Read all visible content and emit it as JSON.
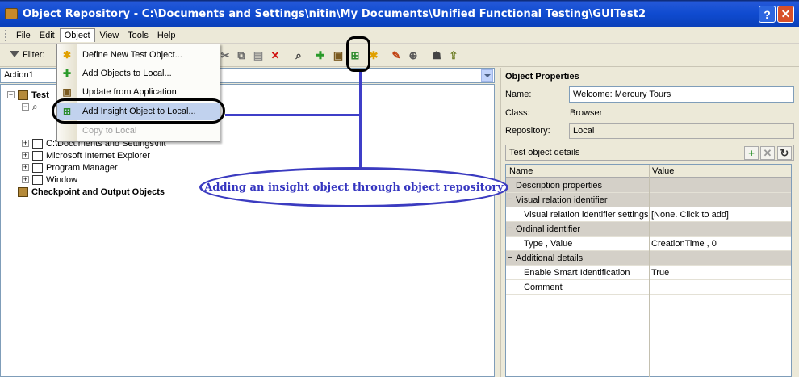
{
  "window": {
    "title": "Object Repository - C:\\Documents and Settings\\nitin\\My Documents\\Unified Functional Testing\\GUITest2"
  },
  "menu": {
    "items": [
      "File",
      "Edit",
      "Object",
      "View",
      "Tools",
      "Help"
    ],
    "open": "Object",
    "object_menu": [
      {
        "label": "Define New Test Object...",
        "icon": "star-icon",
        "enabled": true
      },
      {
        "label": "Add Objects to Local...",
        "icon": "green-plus-icon",
        "enabled": true
      },
      {
        "label": "Update from Application",
        "icon": "repository-update-icon",
        "enabled": true
      },
      {
        "label": "Add Insight Object to Local...",
        "icon": "insight-object-icon",
        "enabled": true
      },
      {
        "label": "Copy to Local",
        "icon": "",
        "enabled": false
      }
    ]
  },
  "toolbar": {
    "filter_label": "Filter:"
  },
  "action_combo": {
    "value": "Action1"
  },
  "tree": {
    "root": "Test",
    "items": [
      {
        "label": "C:\\Documents and Settings\\nit",
        "partial": true
      },
      {
        "label": "Microsoft Internet Explorer"
      },
      {
        "label": "Program Manager"
      },
      {
        "label": "Window"
      }
    ],
    "checkpoint": "Checkpoint and Output Objects"
  },
  "properties": {
    "title": "Object Properties",
    "name_label": "Name:",
    "name_value": "Welcome: Mercury Tours",
    "class_label": "Class:",
    "class_value": "Browser",
    "repository_label": "Repository:",
    "repository_value": "Local",
    "details_label": "Test object details",
    "grid_headers": {
      "name": "Name",
      "value": "Value"
    },
    "grid_rows": [
      {
        "name": "Description properties",
        "value": "",
        "cat": true,
        "toggle": ""
      },
      {
        "name": "Visual relation identifier",
        "value": "",
        "cat": true,
        "toggle": "−"
      },
      {
        "name": "Visual relation identifier settings",
        "value": "[None. Click to add]",
        "cat": false,
        "toggle": ""
      },
      {
        "name": "Ordinal identifier",
        "value": "",
        "cat": true,
        "toggle": "−"
      },
      {
        "name": "Type , Value",
        "value": "CreationTime , 0",
        "cat": false,
        "toggle": ""
      },
      {
        "name": "Additional details",
        "value": "",
        "cat": true,
        "toggle": "−"
      },
      {
        "name": "Enable Smart Identification",
        "value": "True",
        "cat": false,
        "toggle": ""
      },
      {
        "name": "Comment",
        "value": "",
        "cat": false,
        "toggle": ""
      }
    ]
  },
  "annotation": {
    "text": "Adding an insight object through object repository"
  },
  "colors": {
    "title_bar": "#0f4bd0",
    "annotation": "#3b3bc0",
    "highlight": "#c1d2ee"
  }
}
